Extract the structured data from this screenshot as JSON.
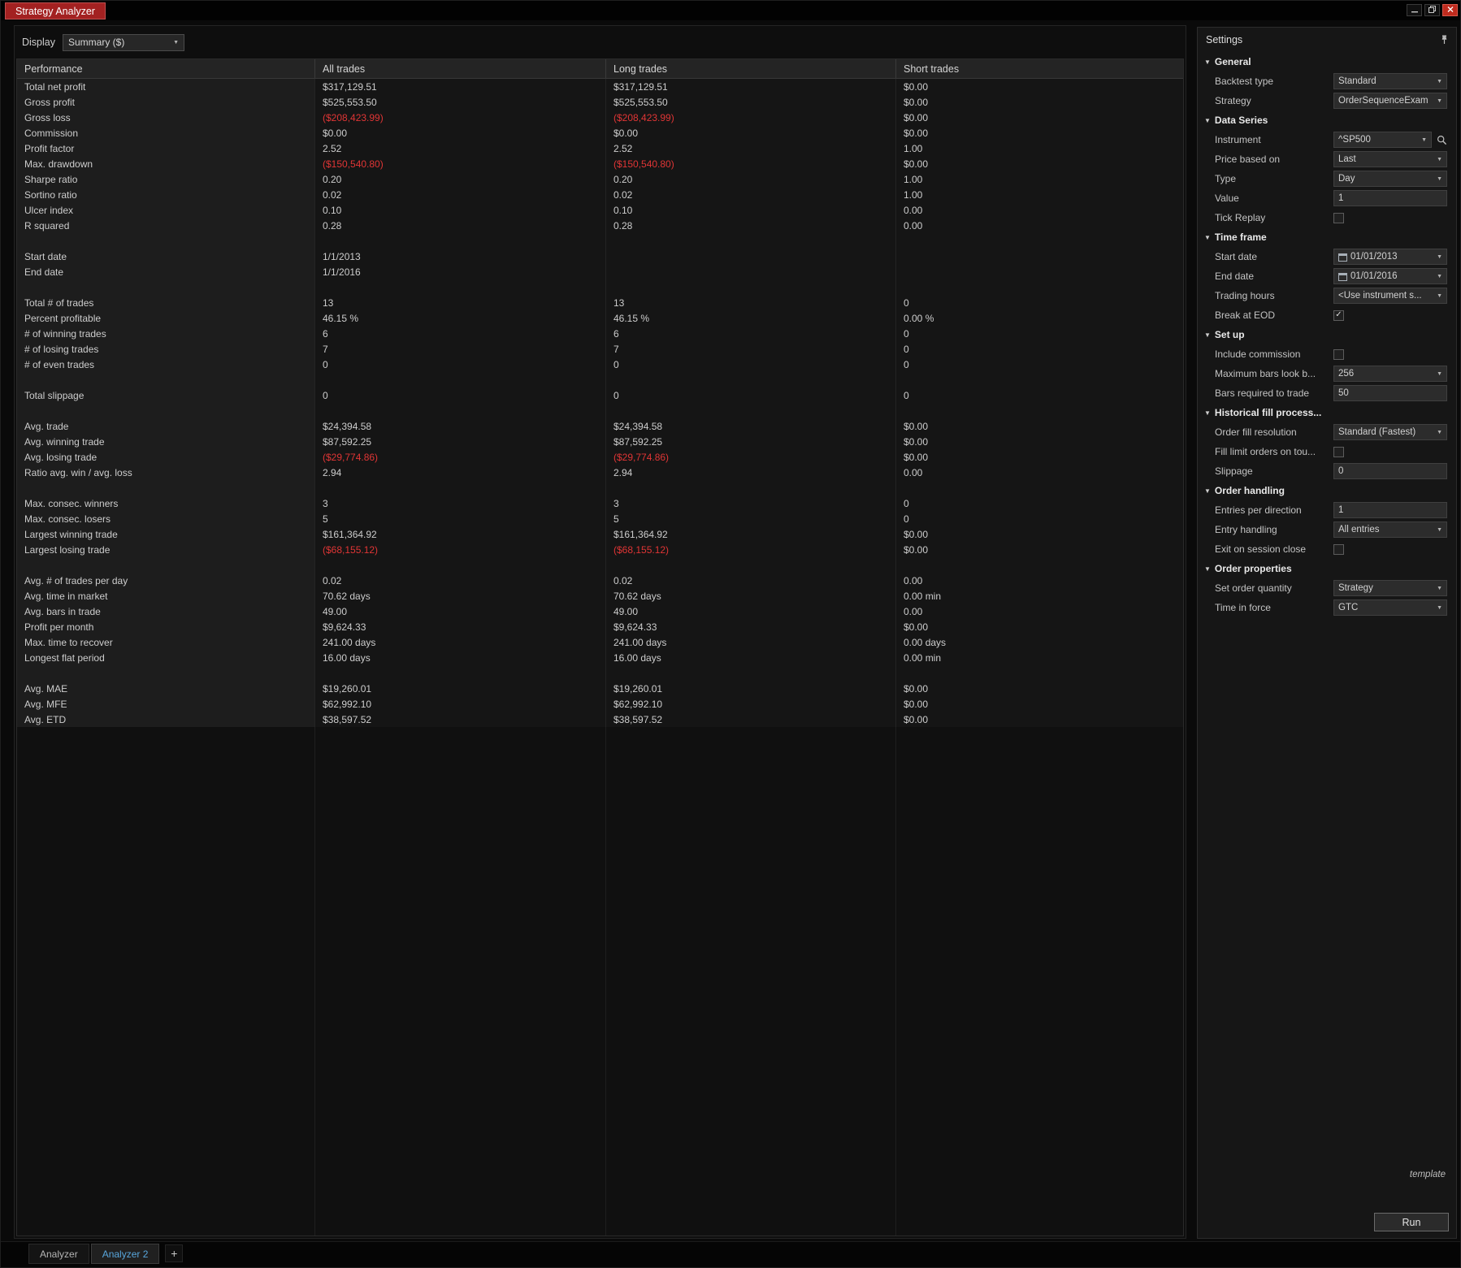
{
  "window": {
    "title": "Strategy Analyzer"
  },
  "colors": {
    "negative": "#e03535",
    "title_tab_red": "#a32121",
    "active_tab_blue": "#58a6dc",
    "close_red": "#bf2b1e"
  },
  "icons": {
    "minimize": "minimize-icon",
    "restore": "restore-icon",
    "close": "close-icon",
    "pin": "pin-icon",
    "calendar": "calendar-icon",
    "search": "search-icon",
    "chevron": "chevron-down-icon",
    "collapse_triangle": "collapse-triangle-icon"
  },
  "toolbar": {
    "display_label": "Display",
    "display_value": "Summary ($)"
  },
  "table": {
    "columns": [
      "Performance",
      "All trades",
      "Long trades",
      "Short trades"
    ],
    "rows": [
      {
        "label": "Total net profit",
        "all": "$317,129.51",
        "long": "$317,129.51",
        "short": "$0.00"
      },
      {
        "label": "Gross profit",
        "all": "$525,553.50",
        "long": "$525,553.50",
        "short": "$0.00"
      },
      {
        "label": "Gross loss",
        "all": "($208,423.99)",
        "long": "($208,423.99)",
        "short": "$0.00"
      },
      {
        "label": "Commission",
        "all": "$0.00",
        "long": "$0.00",
        "short": "$0.00"
      },
      {
        "label": "Profit factor",
        "all": "2.52",
        "long": "2.52",
        "short": "1.00"
      },
      {
        "label": "Max. drawdown",
        "all": "($150,540.80)",
        "long": "($150,540.80)",
        "short": "$0.00"
      },
      {
        "label": "Sharpe ratio",
        "all": "0.20",
        "long": "0.20",
        "short": "1.00"
      },
      {
        "label": "Sortino ratio",
        "all": "0.02",
        "long": "0.02",
        "short": "1.00"
      },
      {
        "label": "Ulcer index",
        "all": "0.10",
        "long": "0.10",
        "short": "0.00"
      },
      {
        "label": "R squared",
        "all": "0.28",
        "long": "0.28",
        "short": "0.00"
      },
      {
        "spacer": true
      },
      {
        "label": "Start date",
        "all": "1/1/2013",
        "long": "",
        "short": ""
      },
      {
        "label": "End date",
        "all": "1/1/2016",
        "long": "",
        "short": ""
      },
      {
        "spacer": true
      },
      {
        "label": "Total # of trades",
        "all": "13",
        "long": "13",
        "short": "0"
      },
      {
        "label": "Percent profitable",
        "all": "46.15 %",
        "long": "46.15 %",
        "short": "0.00 %"
      },
      {
        "label": "# of winning trades",
        "all": "6",
        "long": "6",
        "short": "0"
      },
      {
        "label": "# of losing trades",
        "all": "7",
        "long": "7",
        "short": "0"
      },
      {
        "label": "# of even trades",
        "all": "0",
        "long": "0",
        "short": "0"
      },
      {
        "spacer": true
      },
      {
        "label": "Total slippage",
        "all": "0",
        "long": "0",
        "short": "0"
      },
      {
        "spacer": true
      },
      {
        "label": "Avg. trade",
        "all": "$24,394.58",
        "long": "$24,394.58",
        "short": "$0.00"
      },
      {
        "label": "Avg. winning trade",
        "all": "$87,592.25",
        "long": "$87,592.25",
        "short": "$0.00"
      },
      {
        "label": "Avg. losing trade",
        "all": "($29,774.86)",
        "long": "($29,774.86)",
        "short": "$0.00"
      },
      {
        "label": "Ratio avg. win / avg. loss",
        "all": "2.94",
        "long": "2.94",
        "short": "0.00"
      },
      {
        "spacer": true
      },
      {
        "label": "Max. consec. winners",
        "all": "3",
        "long": "3",
        "short": "0"
      },
      {
        "label": "Max. consec. losers",
        "all": "5",
        "long": "5",
        "short": "0"
      },
      {
        "label": "Largest winning trade",
        "all": "$161,364.92",
        "long": "$161,364.92",
        "short": "$0.00"
      },
      {
        "label": "Largest losing trade",
        "all": "($68,155.12)",
        "long": "($68,155.12)",
        "short": "$0.00"
      },
      {
        "spacer": true
      },
      {
        "label": "Avg. # of trades per day",
        "all": "0.02",
        "long": "0.02",
        "short": "0.00"
      },
      {
        "label": "Avg. time in market",
        "all": "70.62 days",
        "long": "70.62 days",
        "short": "0.00 min"
      },
      {
        "label": "Avg. bars in trade",
        "all": "49.00",
        "long": "49.00",
        "short": "0.00"
      },
      {
        "label": "Profit per month",
        "all": "$9,624.33",
        "long": "$9,624.33",
        "short": "$0.00"
      },
      {
        "label": "Max. time to recover",
        "all": "241.00 days",
        "long": "241.00 days",
        "short": "0.00 days"
      },
      {
        "label": "Longest flat period",
        "all": "16.00 days",
        "long": "16.00 days",
        "short": "0.00 min"
      },
      {
        "spacer": true
      },
      {
        "label": "Avg. MAE",
        "all": "$19,260.01",
        "long": "$19,260.01",
        "short": "$0.00"
      },
      {
        "label": "Avg. MFE",
        "all": "$62,992.10",
        "long": "$62,992.10",
        "short": "$0.00"
      },
      {
        "label": "Avg. ETD",
        "all": "$38,597.52",
        "long": "$38,597.52",
        "short": "$0.00"
      }
    ]
  },
  "settings": {
    "title": "Settings",
    "template_label": "template",
    "run_label": "Run",
    "sections": [
      {
        "label": "General",
        "rows": [
          {
            "label": "Backtest type",
            "control": "select",
            "value": "Standard"
          },
          {
            "label": "Strategy",
            "control": "select",
            "value": "OrderSequenceExam"
          }
        ]
      },
      {
        "label": "Data Series",
        "rows": [
          {
            "label": "Instrument",
            "control": "combo-search",
            "value": "^SP500"
          },
          {
            "label": "Price based on",
            "control": "select",
            "value": "Last"
          },
          {
            "label": "Type",
            "control": "select",
            "value": "Day"
          },
          {
            "label": "Value",
            "control": "input",
            "value": "1"
          },
          {
            "label": "Tick Replay",
            "control": "checkbox",
            "checked": false
          }
        ]
      },
      {
        "label": "Time frame",
        "rows": [
          {
            "label": "Start date",
            "control": "date",
            "value": "01/01/2013"
          },
          {
            "label": "End date",
            "control": "date",
            "value": "01/01/2016"
          },
          {
            "label": "Trading hours",
            "control": "select",
            "value": "<Use instrument s..."
          },
          {
            "label": "Break at EOD",
            "control": "checkbox",
            "checked": true
          }
        ]
      },
      {
        "label": "Set up",
        "rows": [
          {
            "label": "Include commission",
            "control": "checkbox",
            "checked": false
          },
          {
            "label": "Maximum bars look b...",
            "control": "select",
            "value": "256"
          },
          {
            "label": "Bars required to trade",
            "control": "input",
            "value": "50"
          }
        ]
      },
      {
        "label": "Historical fill process...",
        "rows": [
          {
            "label": "Order fill resolution",
            "control": "select",
            "value": "Standard (Fastest)"
          },
          {
            "label": "Fill limit orders on tou...",
            "control": "checkbox",
            "checked": false
          },
          {
            "label": "Slippage",
            "control": "input",
            "value": "0"
          }
        ]
      },
      {
        "label": "Order handling",
        "rows": [
          {
            "label": "Entries per direction",
            "control": "input",
            "value": "1"
          },
          {
            "label": "Entry handling",
            "control": "select",
            "value": "All entries"
          },
          {
            "label": "Exit on session close",
            "control": "checkbox",
            "checked": false
          }
        ]
      },
      {
        "label": "Order properties",
        "rows": [
          {
            "label": "Set order quantity",
            "control": "select",
            "value": "Strategy"
          },
          {
            "label": "Time in force",
            "control": "select",
            "value": "GTC"
          }
        ]
      }
    ]
  },
  "tabs": {
    "items": [
      {
        "label": "Analyzer",
        "active": false
      },
      {
        "label": "Analyzer 2",
        "active": true
      }
    ],
    "add_label": "+"
  }
}
